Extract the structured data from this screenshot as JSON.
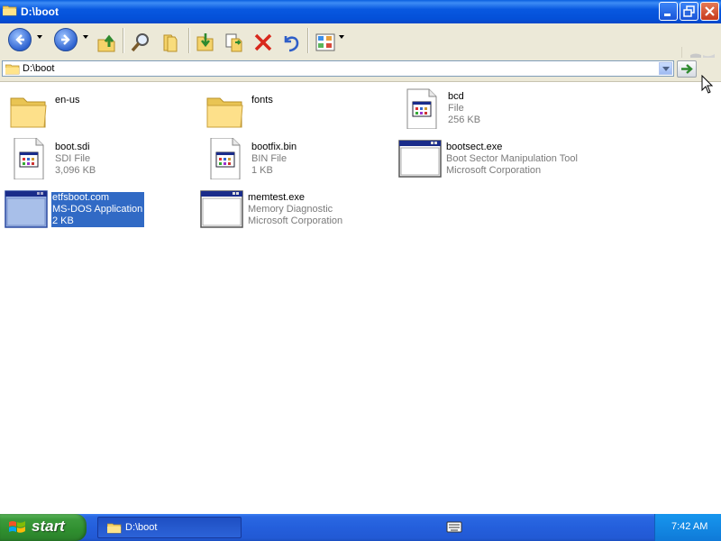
{
  "window": {
    "title": "D:\\boot",
    "controls": [
      "minimize-icon",
      "maximize-icon",
      "close-icon"
    ]
  },
  "toolbar": {
    "buttons": [
      "back-icon",
      "forward-icon",
      "up-folder-icon",
      "search-icon",
      "folders-icon",
      "move-to-icon",
      "copy-to-icon",
      "delete-icon",
      "undo-icon",
      "views-icon"
    ]
  },
  "address": {
    "value": "D:\\boot"
  },
  "files": [
    {
      "name": "en-us",
      "type": "",
      "detail": "",
      "icon": "folder-icon"
    },
    {
      "name": "fonts",
      "type": "",
      "detail": "",
      "icon": "folder-icon"
    },
    {
      "name": "bcd",
      "type": "File",
      "detail": "256 KB",
      "icon": "generic-file-icon"
    },
    {
      "name": "boot.sdi",
      "type": "SDI File",
      "detail": "3,096 KB",
      "icon": "generic-file-icon"
    },
    {
      "name": "bootfix.bin",
      "type": "BIN File",
      "detail": "1 KB",
      "icon": "generic-file-icon"
    },
    {
      "name": "bootsect.exe",
      "type": "Boot Sector Manipulation Tool",
      "detail": "Microsoft Corporation",
      "icon": "application-icon"
    },
    {
      "name": "etfsboot.com",
      "type": "MS-DOS Application",
      "detail": "2 KB",
      "icon": "application-icon",
      "selected": true
    },
    {
      "name": "memtest.exe",
      "type": "Memory Diagnostic",
      "detail": "Microsoft Corporation",
      "icon": "application-icon"
    }
  ],
  "taskbar": {
    "start_label": "start",
    "task_label": "D:\\boot",
    "clock": "7:42 AM"
  },
  "colors": {
    "title_blue": "#0858e0",
    "selection": "#316ac5",
    "start_green": "#3c9a3c",
    "toolbar_bg": "#ece9d8",
    "meta_text": "#7a7a7a"
  }
}
